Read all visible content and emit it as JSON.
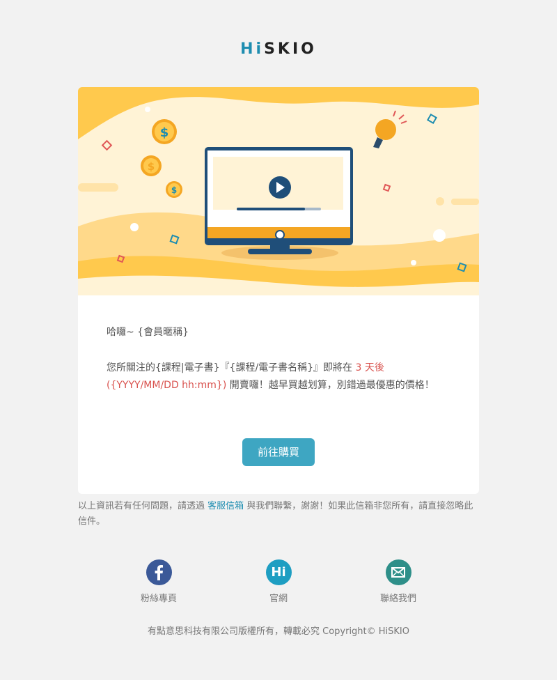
{
  "brand": {
    "logo_hi": "Hi",
    "logo_rest": "SKIO"
  },
  "email": {
    "greeting": "哈囉~ {會員暱稱}",
    "body_part1": "您所關注的{課程|電子書}『{課程/電子書名稱}』即將在 ",
    "body_highlight": "3 天後 ({YYYY/MM/DD hh:mm})",
    "body_part2": " 開賣囉！越早買越划算，別錯過最優惠的價格！",
    "cta_label": "前往購買"
  },
  "note": {
    "part1": "以上資訊若有任何問題，請透過 ",
    "link_text": "客服信箱",
    "part2": " 與我們聯繫，謝謝！如果此信箱非您所有，請直接忽略此信件。"
  },
  "social": [
    {
      "label": "粉絲專頁",
      "icon": "facebook-icon"
    },
    {
      "label": "官網",
      "icon": "hiskio-icon",
      "icon_text": "Hi"
    },
    {
      "label": "聯絡我們",
      "icon": "mail-icon"
    }
  ],
  "footer": {
    "copyright": "有點意思科技有限公司版權所有，轉載必究 Copyright© HiSKIO"
  },
  "colors": {
    "accent": "#3ea6c2",
    "brand_blue": "#1e8db0",
    "highlight": "#d9534f",
    "hero_yellow": "#ffc94d"
  }
}
